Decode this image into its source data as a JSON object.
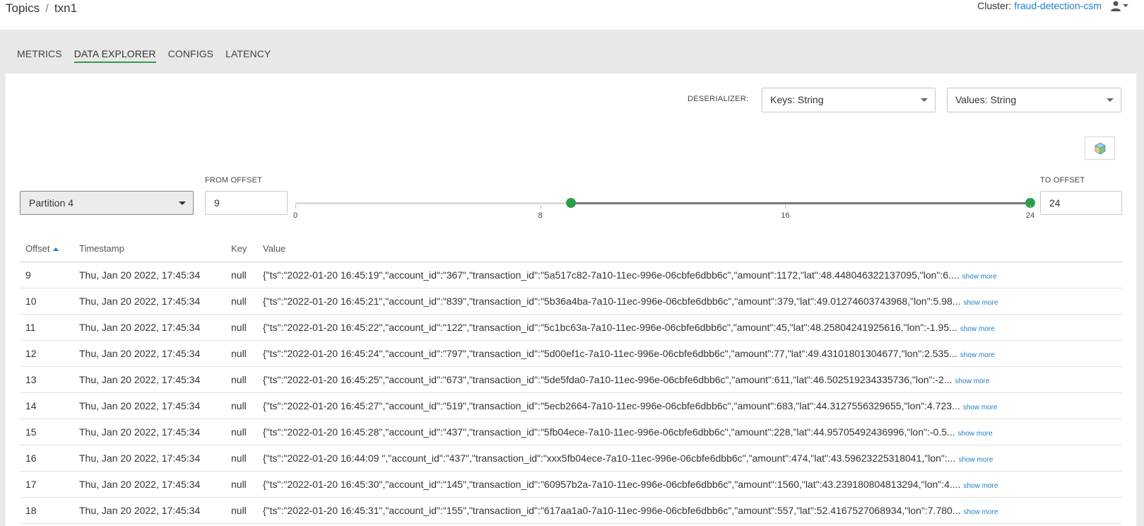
{
  "breadcrumb": {
    "root": "Topics",
    "separator": "/",
    "current": "txn1"
  },
  "cluster": {
    "label": "Cluster:",
    "name": "fraud-detection-csm"
  },
  "tabs": [
    {
      "label": "METRICS",
      "active": false
    },
    {
      "label": "DATA EXPLORER",
      "active": true
    },
    {
      "label": "CONFIGS",
      "active": false
    },
    {
      "label": "LATENCY",
      "active": false
    }
  ],
  "deserializer": {
    "label": "DESERIALIZER:",
    "keys": "Keys: String",
    "values": "Values: String"
  },
  "partition": {
    "selected": "Partition 4"
  },
  "offsets": {
    "from_label": "FROM OFFSET",
    "from_value": "9",
    "to_label": "TO OFFSET",
    "to_value": "24",
    "slider": {
      "min": 0,
      "max": 24,
      "low": 9,
      "high": 24,
      "ticks": [
        "0",
        "8",
        "16",
        "24"
      ]
    }
  },
  "table": {
    "headers": {
      "offset": "Offset",
      "timestamp": "Timestamp",
      "key": "Key",
      "value": "Value"
    },
    "show_more": "show more",
    "rows": [
      {
        "offset": "9",
        "timestamp": "Thu, Jan 20 2022, 17:45:34",
        "key": "null",
        "value": "{\"ts\":\"2022-01-20 16:45:19\",\"account_id\":\"367\",\"transaction_id\":\"5a517c82-7a10-11ec-996e-06cbfe6dbb6c\",\"amount\":1172,\"lat\":48.448046322137095,\"lon\":6...."
      },
      {
        "offset": "10",
        "timestamp": "Thu, Jan 20 2022, 17:45:34",
        "key": "null",
        "value": "{\"ts\":\"2022-01-20 16:45:21\",\"account_id\":\"839\",\"transaction_id\":\"5b36a4ba-7a10-11ec-996e-06cbfe6dbb6c\",\"amount\":379,\"lat\":49.01274603743968,\"lon\":5.98..."
      },
      {
        "offset": "11",
        "timestamp": "Thu, Jan 20 2022, 17:45:34",
        "key": "null",
        "value": "{\"ts\":\"2022-01-20 16:45:22\",\"account_id\":\"122\",\"transaction_id\":\"5c1bc63a-7a10-11ec-996e-06cbfe6dbb6c\",\"amount\":45,\"lat\":48.25804241925616,\"lon\":-1.95..."
      },
      {
        "offset": "12",
        "timestamp": "Thu, Jan 20 2022, 17:45:34",
        "key": "null",
        "value": "{\"ts\":\"2022-01-20 16:45:24\",\"account_id\":\"797\",\"transaction_id\":\"5d00ef1c-7a10-11ec-996e-06cbfe6dbb6c\",\"amount\":77,\"lat\":49.43101801304677,\"lon\":2.535..."
      },
      {
        "offset": "13",
        "timestamp": "Thu, Jan 20 2022, 17:45:34",
        "key": "null",
        "value": "{\"ts\":\"2022-01-20 16:45:25\",\"account_id\":\"673\",\"transaction_id\":\"5de5fda0-7a10-11ec-996e-06cbfe6dbb6c\",\"amount\":611,\"lat\":46.502519234335736,\"lon\":-2..."
      },
      {
        "offset": "14",
        "timestamp": "Thu, Jan 20 2022, 17:45:34",
        "key": "null",
        "value": "{\"ts\":\"2022-01-20 16:45:27\",\"account_id\":\"519\",\"transaction_id\":\"5ecb2664-7a10-11ec-996e-06cbfe6dbb6c\",\"amount\":683,\"lat\":44.3127556329655,\"lon\":4.723..."
      },
      {
        "offset": "15",
        "timestamp": "Thu, Jan 20 2022, 17:45:34",
        "key": "null",
        "value": "{\"ts\":\"2022-01-20 16:45:28\",\"account_id\":\"437\",\"transaction_id\":\"5fb04ece-7a10-11ec-996e-06cbfe6dbb6c\",\"amount\":228,\"lat\":44.95705492436996,\"lon\":-0.5..."
      },
      {
        "offset": "16",
        "timestamp": "Thu, Jan 20 2022, 17:45:34",
        "key": "null",
        "value": "{\"ts\":\"2022-01-20 16:44:09 \",\"account_id\":\"437\",\"transaction_id\":\"xxx5fb04ece-7a10-11ec-996e-06cbfe6dbb6c\",\"amount\":474,\"lat\":43.59623225318041,\"lon\":..."
      },
      {
        "offset": "17",
        "timestamp": "Thu, Jan 20 2022, 17:45:34",
        "key": "null",
        "value": "{\"ts\":\"2022-01-20 16:45:30\",\"account_id\":\"145\",\"transaction_id\":\"60957b2a-7a10-11ec-996e-06cbfe6dbb6c\",\"amount\":1560,\"lat\":43.239180804813294,\"lon\":4...."
      },
      {
        "offset": "18",
        "timestamp": "Thu, Jan 20 2022, 17:45:34",
        "key": "null",
        "value": "{\"ts\":\"2022-01-20 16:45:31\",\"account_id\":\"155\",\"transaction_id\":\"617aa1a0-7a10-11ec-996e-06cbfe6dbb6c\",\"amount\":557,\"lat\":52.4167527068934,\"lon\":7.780..."
      }
    ]
  }
}
